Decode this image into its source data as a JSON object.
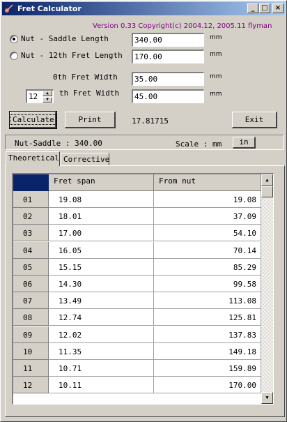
{
  "window": {
    "title": "Fret Calculator",
    "controls": {
      "minimize": "_",
      "maximize": "□",
      "close": "×"
    }
  },
  "version_text": "Version 0.33  Copyright(c) 2004.12, 2005.11 flyman",
  "form": {
    "nut_saddle": {
      "label": "Nut - Saddle Length",
      "value": "340.00",
      "unit": "mm",
      "selected": true
    },
    "nut_12th": {
      "label": "Nut - 12th Fret Length",
      "value": "170.00",
      "unit": "mm",
      "selected": false
    },
    "fret0_width": {
      "label": "0th Fret Width",
      "value": "35.00",
      "unit": "mm"
    },
    "fretn_width": {
      "spin_value": "12",
      "label": "th Fret Width",
      "value": "45.00",
      "unit": "mm"
    }
  },
  "buttons": {
    "calculate": "Calculate",
    "print": "Print",
    "exit": "Exit"
  },
  "result_value": "17.81715",
  "status": {
    "nut_saddle_text": "Nut-Saddle : 340.00",
    "scale_label": "Scale : mm",
    "scale_button": "in"
  },
  "tabs": [
    "Theoretical",
    "Corrective"
  ],
  "table": {
    "headers": [
      "Fret span",
      "From nut"
    ],
    "rows": [
      [
        "01",
        "19.08",
        "19.08"
      ],
      [
        "02",
        "18.01",
        "37.09"
      ],
      [
        "03",
        "17.00",
        "54.10"
      ],
      [
        "04",
        "16.05",
        "70.14"
      ],
      [
        "05",
        "15.15",
        "85.29"
      ],
      [
        "06",
        "14.30",
        "99.58"
      ],
      [
        "07",
        "13.49",
        "113.08"
      ],
      [
        "08",
        "12.74",
        "125.81"
      ],
      [
        "09",
        "12.02",
        "137.83"
      ],
      [
        "10",
        "11.35",
        "149.18"
      ],
      [
        "11",
        "10.71",
        "159.89"
      ],
      [
        "12",
        "10.11",
        "170.00"
      ]
    ]
  },
  "colors": {
    "title_bar": "#0a246a",
    "version_text": "#800080",
    "window_bg": "#d4d0c8"
  }
}
